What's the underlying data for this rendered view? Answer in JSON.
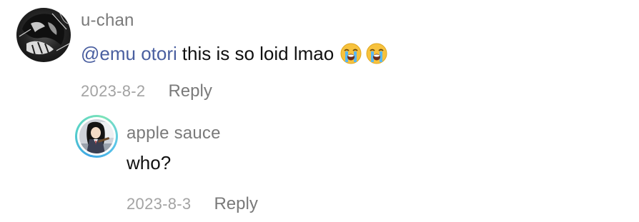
{
  "comment": {
    "username": "u-chan",
    "mention": "@emu otori",
    "text": "this is so loid lmao",
    "emojis": [
      "loudly-crying-face",
      "loudly-crying-face"
    ],
    "date": "2023-8-2",
    "reply_label": "Reply"
  },
  "reply": {
    "username": "apple sauce",
    "text": "who?",
    "date": "2023-8-3",
    "reply_label": "Reply"
  },
  "colors": {
    "mention": "#4a5fa0",
    "username": "#7a7a7a",
    "text": "#111111",
    "date": "#a3a3a3",
    "reply_avatar_ring": "#56d1c9"
  }
}
